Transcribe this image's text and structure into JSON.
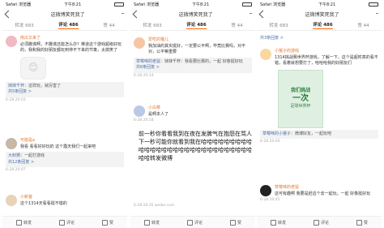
{
  "panels": [
    {
      "status": {
        "left": "Safari 浏览器",
        "time": "下午8:21"
      },
      "nav": {
        "title": "这微博笑死我了"
      },
      "tabs": [
        "转发 683",
        "评论 486",
        "赞 44"
      ],
      "comments": [
        {
          "name": "南瓜又来了",
          "text": "必须撒谎啊，不撒谎还能怎么办？难道这个游戏超级好玩的，我和我的好朋友都玩到停不下来的节奏，太搞笑了",
          "sticker": "😊",
          "reply": {
            "user": "妹妹千杯",
            "text": "这样玩，就厉害了"
          },
          "meta": "6-28 20:03",
          "replies_count": "共5条回复 >"
        },
        {
          "name": "可能是a",
          "text": "我看 看看好好玩的 这个露天我们一起来吧",
          "reply": {
            "user": "大刺猬",
            "text": "一起打游戏"
          },
          "meta": "6-28 20:07",
          "replies_count": "共12条回复 >"
        },
        {
          "name": "小新爸",
          "text": "这个1314天看看挺不错的",
          "meta": ""
        }
      ],
      "toolbar": [
        "转发",
        "评论",
        "赞"
      ]
    },
    {
      "status": {
        "left": "Safari 浏览器",
        "time": "下午8:21"
      },
      "nav": {
        "title": "这微博笑死我了"
      },
      "tabs": [
        "转发 683",
        "评论 486",
        "赞 44"
      ],
      "comments": [
        {
          "name": "爱吃的猫儿",
          "text": "我加油的其实挺好，一定要公平啊，毕竟比赛吗，对不对，公平嘛重要",
          "reply": {
            "user": "草莓味的老鼠",
            "text": "妹妹千杯：我看要比赛的，一起 好像挺好玩"
          },
          "meta": "6-28 20:14",
          "replies_count": "共6条回复 >"
        },
        {
          "name": "小白菜",
          "text": "是啊本人了",
          "meta": "6-28 20:18"
        }
      ],
      "big_text": "前一秒你看看我到在夜在发脾气在抱怨在骂人\n下一秒可能你就看到我在哈哈哈哈哈哈哈哈哈哈哈哈哈哈哈哈哈哈哈哈哈哈哈哈哈哈哈哈哈哈哈转发微博",
      "footer_meta": "6-28 20:35 weibo.com",
      "toolbar": [
        "转发",
        "评论",
        "赞"
      ]
    },
    {
      "status": {
        "left": "Safari 浏览器",
        "time": "下午8:21"
      },
      "nav": {
        "title": "这微博笑死我了"
      },
      "tabs": [
        "转发 683",
        "评论 486",
        "赞 44"
      ],
      "comments": [
        {
          "name": "",
          "text": "共3条回复 >",
          "meta": ""
        },
        {
          "name": "小猴子的游戏",
          "text": "1314挑战赛世界杯游戏，了解一下，这个是超时真的看不错，看着就想要打了，哈哈哈我的好朋友们",
          "reply": {
            "user": "草莓味的小猴子",
            "text": "微博好友，一起玩吧"
          },
          "meta": "6-28 20:40"
        },
        {
          "name": "草莓味的老鼠",
          "text": "这可有趣啊 我要是赶这个去一起玩，一起 好像挺好玩",
          "meta": "6-28 20:45"
        }
      ],
      "poster": {
        "line1": "我们挑战",
        "line2": "一次",
        "line3": "足球世界杯"
      },
      "toolbar": [
        "转发",
        "评论",
        "赞"
      ]
    }
  ]
}
